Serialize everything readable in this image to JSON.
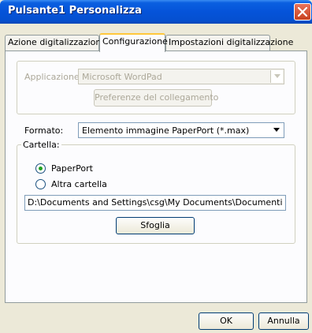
{
  "window": {
    "title": "Pulsante1 Personalizza"
  },
  "tabs": [
    {
      "label": "Azione digitalizzazione",
      "active": false
    },
    {
      "label": "Configurazione",
      "active": true
    },
    {
      "label": "Impostazioni digitalizzazione",
      "active": false
    }
  ],
  "applicazione": {
    "label": "Applicazione:",
    "value": "Microsoft WordPad",
    "link_button": "Preferenze del collegamento"
  },
  "formato": {
    "label": "Formato:",
    "value": "Elemento immagine PaperPort (*.max)"
  },
  "cartella": {
    "label": "Cartella:",
    "option_paperport": "PaperPort",
    "option_altra": "Altra cartella",
    "selected": "PaperPort",
    "path": "D:\\Documents and Settings\\csg\\My Documents\\Documenti PaperPort",
    "browse_button": "Sfoglia"
  },
  "footer": {
    "ok": "OK",
    "cancel": "Annulla"
  }
}
